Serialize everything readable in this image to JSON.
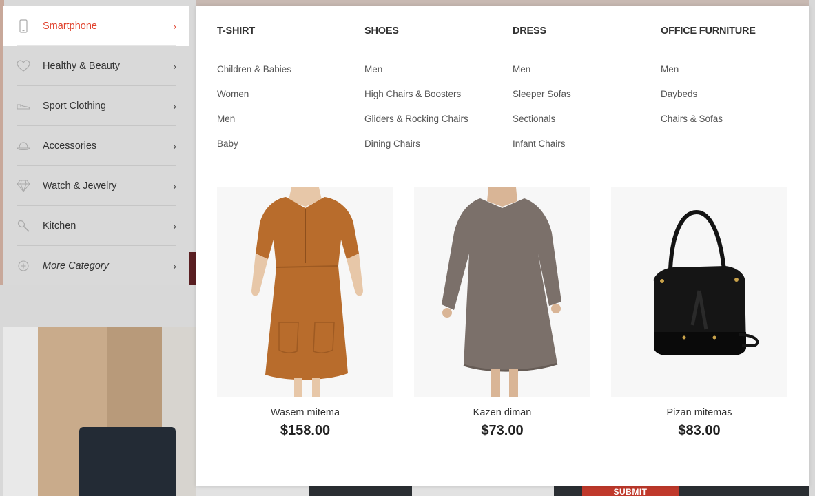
{
  "background": {
    "submit_label": "SUBMIT"
  },
  "sidebar": {
    "items": [
      {
        "label": "Smartphone",
        "icon": "smartphone-icon",
        "active": true
      },
      {
        "label": "Healthy & Beauty",
        "icon": "heart-icon"
      },
      {
        "label": "Sport Clothing",
        "icon": "sneaker-icon"
      },
      {
        "label": "Accessories",
        "icon": "hat-icon"
      },
      {
        "label": "Watch & Jewelry",
        "icon": "diamond-icon"
      },
      {
        "label": "Kitchen",
        "icon": "spoon-icon"
      },
      {
        "label": "More Category",
        "icon": "plus-circle-icon"
      }
    ],
    "chevron": "›"
  },
  "mega_menu": {
    "columns": [
      {
        "heading": "T-SHIRT",
        "links": [
          "Children & Babies",
          "Women",
          "Men",
          "Baby"
        ]
      },
      {
        "heading": "SHOES",
        "links": [
          "Men",
          "High Chairs & Boosters",
          "Gliders & Rocking Chairs",
          "Dining Chairs"
        ]
      },
      {
        "heading": "DRESS",
        "links": [
          "Men",
          "Sleeper Sofas",
          "Sectionals",
          "Infant Chairs"
        ]
      },
      {
        "heading": "OFFICE FURNITURE",
        "links": [
          "Men",
          "Daybeds",
          "Chairs & Sofas"
        ]
      }
    ],
    "products": [
      {
        "name": "Wasem mitema",
        "price": "$158.00"
      },
      {
        "name": "Kazen diman",
        "price": "$73.00"
      },
      {
        "name": "Pizan mitemas",
        "price": "$83.00"
      }
    ]
  },
  "colors": {
    "accent": "#e0412c",
    "menu_bg": "#d9d9d9"
  }
}
